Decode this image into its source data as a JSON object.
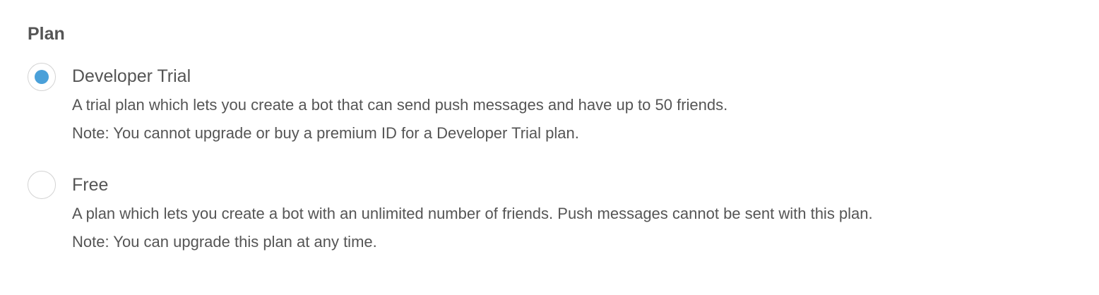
{
  "section": {
    "title": "Plan"
  },
  "options": [
    {
      "label": "Developer Trial",
      "selected": true,
      "description": "A trial plan which lets you create a bot that can send push messages and have up to 50 friends.",
      "note": "Note: You cannot upgrade or buy a premium ID for a Developer Trial plan."
    },
    {
      "label": "Free",
      "selected": false,
      "description": "A plan which lets you create a bot with an unlimited number of friends. Push messages cannot be sent with this plan.",
      "note": "Note: You can upgrade this plan at any time."
    }
  ],
  "colors": {
    "selected_radio": "#4aa0d9",
    "text": "#555555",
    "radio_border": "#d3d3d3"
  }
}
